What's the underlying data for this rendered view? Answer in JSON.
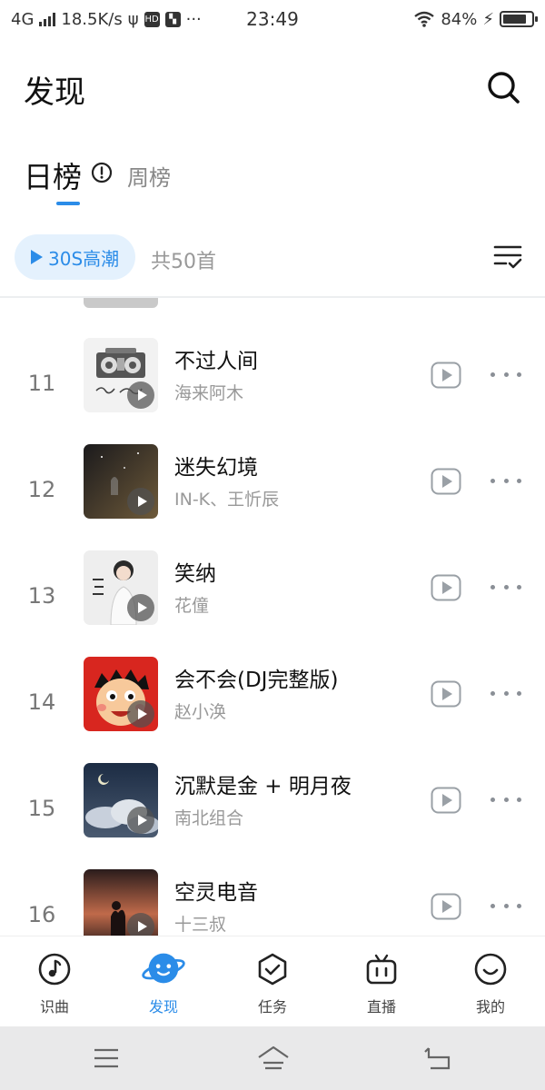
{
  "status_bar": {
    "network": "4G",
    "speed": "18.5K/s",
    "time": "23:49",
    "battery_text": "84%",
    "battery_level": 0.84,
    "more_dots": "···"
  },
  "header": {
    "title": "发现",
    "search_icon": "search-icon"
  },
  "tabs": {
    "daily": "日榜",
    "weekly": "周榜",
    "active": "daily",
    "info_icon": "info-icon"
  },
  "toolbar": {
    "preview_label": "30S高潮",
    "count_text": "共50首",
    "sort_icon": "sort-check-icon"
  },
  "songs": [
    {
      "rank": "11",
      "title": "不过人间",
      "artist": "海来阿木",
      "cover": "cover-boombox"
    },
    {
      "rank": "12",
      "title": "迷失幻境",
      "artist": "IN-K、王忻辰",
      "cover": "cover-dark-night"
    },
    {
      "rank": "13",
      "title": "笑纳",
      "artist": "花僮",
      "cover": "cover-girl-portrait"
    },
    {
      "rank": "14",
      "title": "会不会(DJ完整版)",
      "artist": "赵小涣",
      "cover": "cover-cartoon-face"
    },
    {
      "rank": "15",
      "title": "沉默是金 + 明月夜",
      "artist": "南北组合",
      "cover": "cover-clouds-moon"
    },
    {
      "rank": "16",
      "title": "空灵电音",
      "artist": "十三叔",
      "cover": "cover-sunset-silhouette"
    }
  ],
  "bottom_nav": [
    {
      "label": "识曲",
      "icon": "music-note-icon",
      "active": false
    },
    {
      "label": "发现",
      "icon": "planet-icon",
      "active": true
    },
    {
      "label": "任务",
      "icon": "shield-check-icon",
      "active": false
    },
    {
      "label": "直播",
      "icon": "tv-icon",
      "active": false
    },
    {
      "label": "我的",
      "icon": "smile-icon",
      "active": false
    }
  ],
  "colors": {
    "accent": "#2b8ce8",
    "accent_light": "#e4f1fd",
    "text_primary": "#111111",
    "text_secondary": "#999999"
  }
}
